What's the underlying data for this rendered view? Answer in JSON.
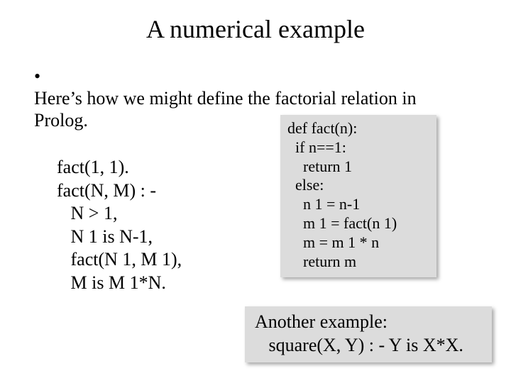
{
  "title": "A numerical example",
  "bullet": {
    "marker": "•",
    "text": "Here’s how we might define the factorial relation in Prolog."
  },
  "prolog": {
    "l1": "fact(1, 1).",
    "l2": "fact(N, M) : -",
    "l3": "   N > 1,",
    "l4": "   N 1 is N-1,",
    "l5": "   fact(N 1, M 1),",
    "l6": "   M is M 1*N."
  },
  "python": {
    "l1": "def fact(n):",
    "l2": "  if n==1:",
    "l3": "    return 1",
    "l4": "  else:",
    "l5": "    n 1 = n-1",
    "l6": "    m 1 = fact(n 1)",
    "l7": "    m = m 1 * n",
    "l8": "    return m"
  },
  "example": {
    "line1": "Another example:",
    "line2": "   square(X, Y) : - Y is X*X."
  }
}
